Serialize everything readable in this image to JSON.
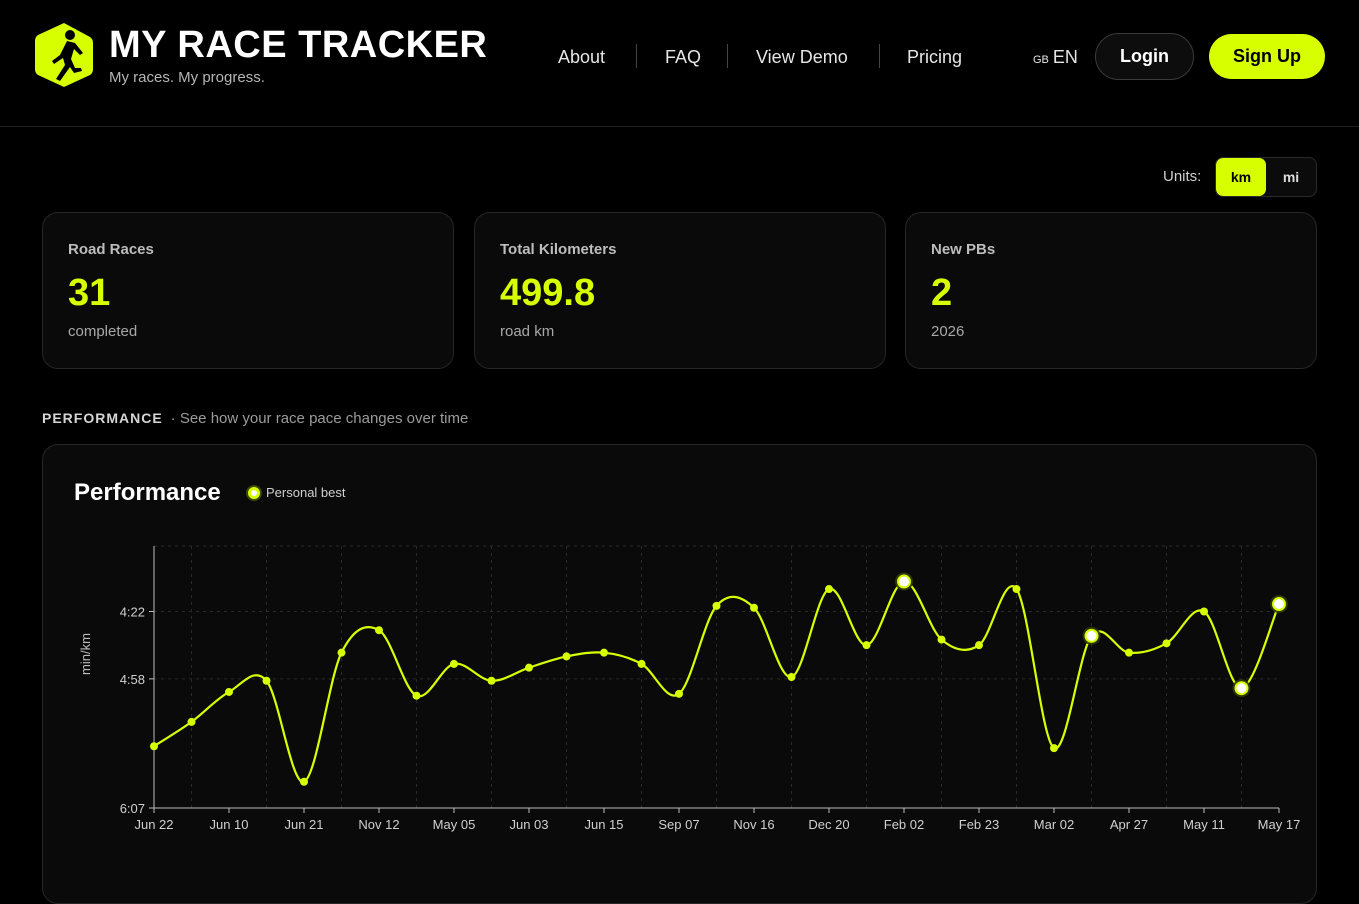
{
  "brand": {
    "title": "MY RACE TRACKER",
    "tagline": "My races. My progress.",
    "accent": "#d8ff00"
  },
  "nav": {
    "items": [
      "About",
      "FAQ",
      "View Demo",
      "Pricing"
    ],
    "lang_flag": "GB",
    "lang_label": "EN",
    "login": "Login",
    "signup": "Sign Up"
  },
  "units": {
    "label": "Units:",
    "options": [
      "km",
      "mi"
    ],
    "selected": "km"
  },
  "stats": [
    {
      "label": "Road Races",
      "value": "31",
      "sub": "completed"
    },
    {
      "label": "Total Kilometers",
      "value": "499.8",
      "sub": "road km"
    },
    {
      "label": "New PBs",
      "value": "2",
      "sub": "2026"
    }
  ],
  "section": {
    "title": "PERFORMANCE",
    "subtitle": "· See how your race pace changes over time"
  },
  "chart_card": {
    "title": "Performance",
    "legend_label": "Personal best"
  },
  "chart_data": {
    "type": "line",
    "ylabel": "min/km",
    "y_ticks": [
      "4:22",
      "4:58",
      "6:07"
    ],
    "y_tick_seconds": [
      262,
      298,
      367
    ],
    "y_range_seconds": [
      227,
      367
    ],
    "y_inverted": true,
    "x_tick_labels": [
      "Jun 22",
      "Jun 10",
      "Jun 21",
      "Nov 12",
      "May 05",
      "Jun 03",
      "Jun 15",
      "Sep 07",
      "Nov 16",
      "Dec 20",
      "Feb 02",
      "Feb 23",
      "Mar 02",
      "Apr 27",
      "May 11",
      "May 17"
    ],
    "grid": true,
    "series": [
      {
        "values": [
          334,
          321,
          305,
          299,
          353,
          284,
          272,
          307,
          290,
          299,
          292,
          286,
          284,
          290,
          306,
          259,
          260,
          297,
          250,
          280,
          246,
          277,
          280,
          250,
          335,
          275,
          284,
          279,
          262,
          303,
          258
        ],
        "pb_flags": [
          0,
          0,
          0,
          0,
          0,
          0,
          0,
          0,
          0,
          0,
          0,
          0,
          0,
          0,
          0,
          0,
          0,
          0,
          0,
          0,
          1,
          0,
          0,
          0,
          0,
          1,
          0,
          0,
          0,
          1,
          1
        ]
      }
    ]
  }
}
